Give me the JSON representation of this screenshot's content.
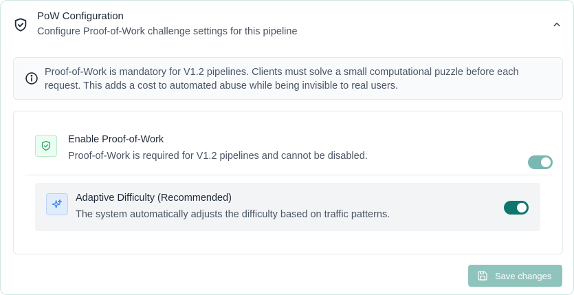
{
  "header": {
    "title": "PoW Configuration",
    "subtitle": "Configure Proof-of-Work challenge settings for this pipeline",
    "icon": "shield-check-icon",
    "collapse_icon": "chevron-up-icon"
  },
  "info": {
    "icon": "info-icon",
    "text": "Proof-of-Work is mandatory for V1.2 pipelines. Clients must solve a small computational puzzle before each request. This adds a cost to automated abuse while being invisible to real users."
  },
  "settings": {
    "pow": {
      "title": "Enable Proof-of-Work",
      "description": "Proof-of-Work is required for V1.2 pipelines and cannot be disabled.",
      "icon": "shield-check-icon",
      "enabled": true,
      "locked": true
    },
    "adaptive": {
      "title": "Adaptive Difficulty (Recommended)",
      "description": "The system automatically adjusts the difficulty based on traffic patterns.",
      "icon": "sparkles-icon",
      "enabled": true
    }
  },
  "actions": {
    "save_label": "Save changes",
    "save_icon": "save-icon"
  },
  "colors": {
    "accent": "#0f766e",
    "accent_disabled": "#7bb8b1",
    "save_button": "#8fc4bd",
    "success_icon": "#22a55a",
    "sparkle_icon": "#3b82f6"
  }
}
